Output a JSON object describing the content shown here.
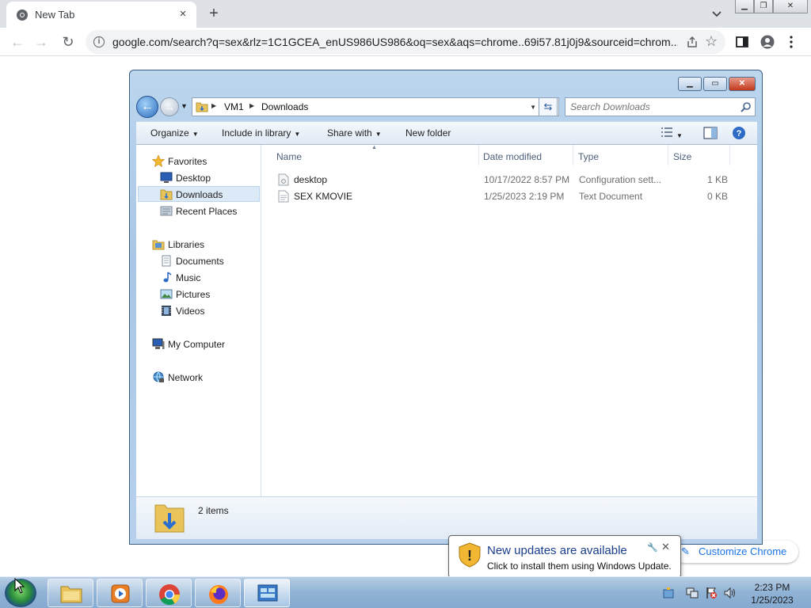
{
  "browser": {
    "tab_title": "New Tab",
    "tab_close": "×",
    "new_tab": "+",
    "url": "google.com/search?q=sex&rlz=1C1GCEA_enUS986US986&oq=sex&aqs=chrome..69i57.81j0j9&sourceid=chrom...",
    "customize_label": "Customize Chrome"
  },
  "explorer": {
    "breadcrumb": [
      "VM1",
      "Downloads"
    ],
    "search_placeholder": "Search Downloads",
    "commands": {
      "organize": "Organize",
      "include": "Include in library",
      "share": "Share with",
      "new_folder": "New folder"
    },
    "nav": {
      "favorites": "Favorites",
      "desktop": "Desktop",
      "downloads": "Downloads",
      "recent": "Recent Places",
      "libraries": "Libraries",
      "documents": "Documents",
      "music": "Music",
      "pictures": "Pictures",
      "videos": "Videos",
      "computer": "My Computer",
      "network": "Network"
    },
    "columns": [
      "Name",
      "Date modified",
      "Type",
      "Size"
    ],
    "files": [
      {
        "name": "desktop",
        "date": "10/17/2022 8:57 PM",
        "type": "Configuration sett...",
        "size": "1 KB"
      },
      {
        "name": "SEX KMOVIE",
        "date": "1/25/2023 2:19 PM",
        "type": "Text Document",
        "size": "0 KB"
      }
    ],
    "status": "2 items"
  },
  "notification": {
    "title": "New updates are available",
    "message": "Click to install them using Windows Update."
  },
  "taskbar": {
    "time": "2:23 PM",
    "date": "1/25/2023"
  }
}
